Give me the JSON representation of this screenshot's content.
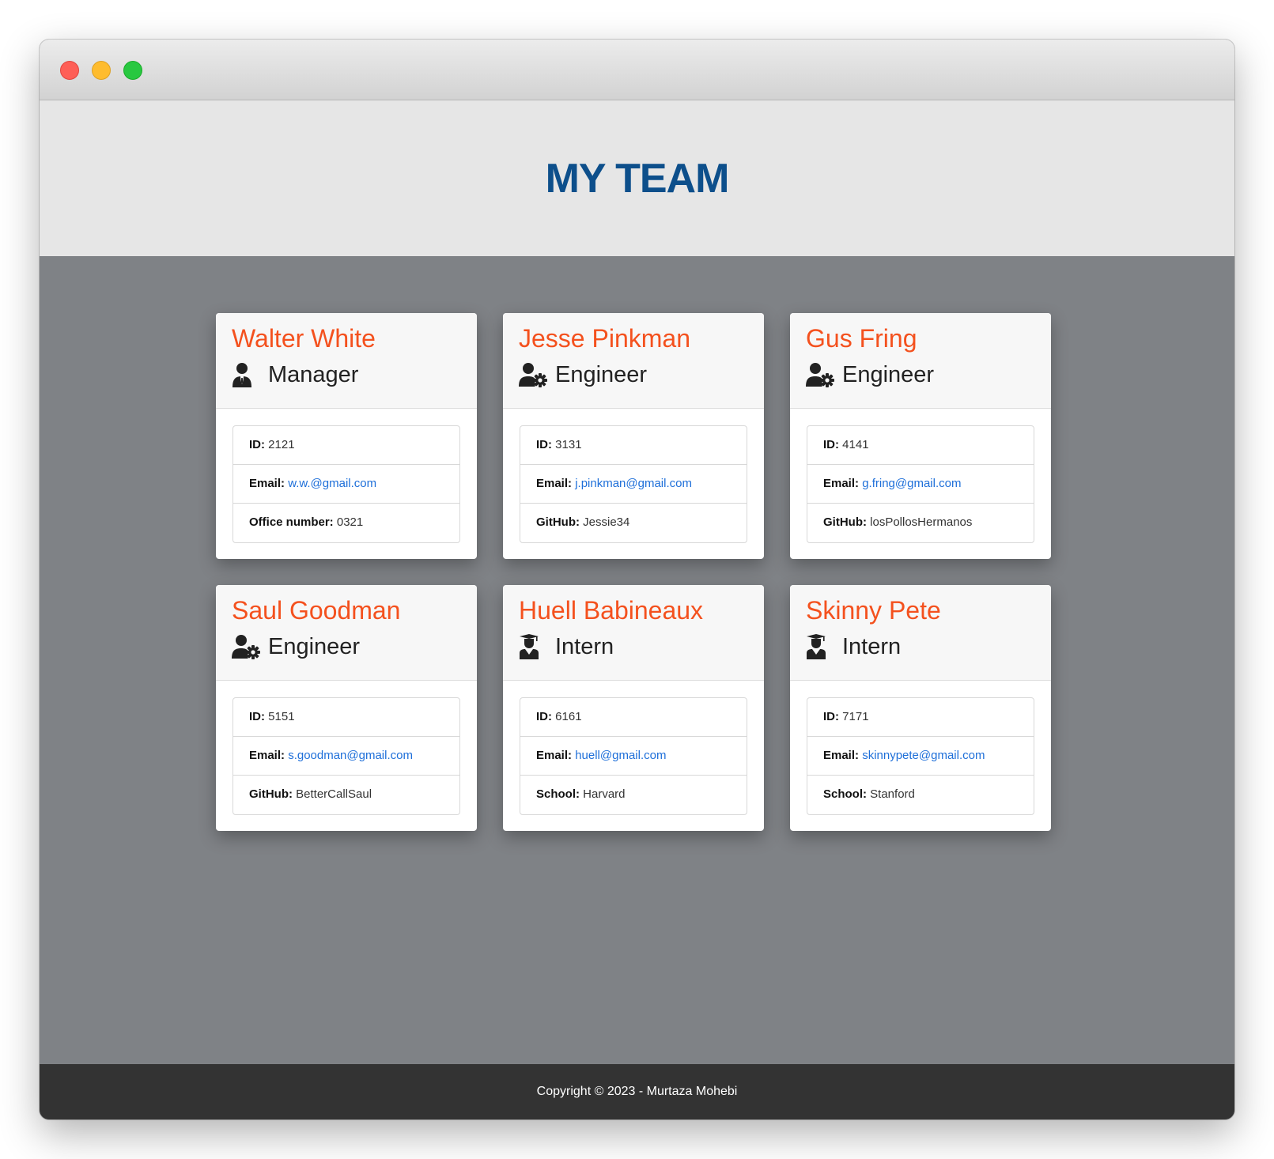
{
  "header": {
    "title": "MY TEAM"
  },
  "labels": {
    "id": "ID:",
    "email": "Email:",
    "office": "Office number:",
    "github": "GitHub:",
    "school": "School:"
  },
  "colors": {
    "title": "#0d4f8b",
    "name": "#f4511e",
    "link": "#1e6fd9",
    "background": "#7f8286",
    "footer": "#333333"
  },
  "employees": [
    {
      "name": "Walter White",
      "role": "Manager",
      "icon": "manager-icon",
      "id": "2121",
      "email": "w.w.@gmail.com",
      "extra": "0321"
    },
    {
      "name": "Jesse Pinkman",
      "role": "Engineer",
      "icon": "engineer-icon",
      "id": "3131",
      "email": "j.pinkman@gmail.com",
      "extra": "Jessie34"
    },
    {
      "name": "Gus Fring",
      "role": "Engineer",
      "icon": "engineer-icon",
      "id": "4141",
      "email": "g.fring@gmail.com",
      "extra": "losPollosHermanos"
    },
    {
      "name": "Saul Goodman",
      "role": "Engineer",
      "icon": "engineer-icon",
      "id": "5151",
      "email": "s.goodman@gmail.com",
      "extra": "BetterCallSaul"
    },
    {
      "name": "Huell Babineaux",
      "role": "Intern",
      "icon": "graduate-icon",
      "id": "6161",
      "email": "huell@gmail.com",
      "extra": "Harvard"
    },
    {
      "name": "Skinny Pete",
      "role": "Intern",
      "icon": "graduate-icon",
      "id": "7171",
      "email": "skinnypete@gmail.com",
      "extra": "Stanford"
    }
  ],
  "footer": {
    "text": "Copyright © 2023 - Murtaza Mohebi"
  }
}
